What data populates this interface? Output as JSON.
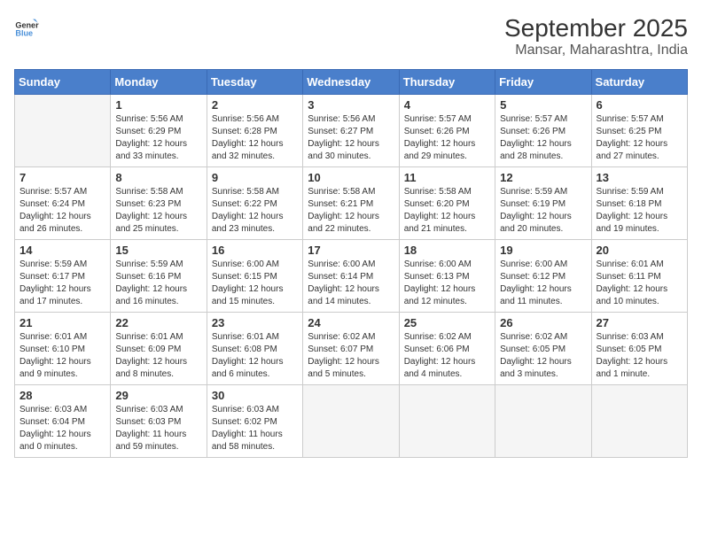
{
  "header": {
    "logo_line1": "General",
    "logo_line2": "Blue",
    "title": "September 2025",
    "subtitle": "Mansar, Maharashtra, India"
  },
  "weekdays": [
    "Sunday",
    "Monday",
    "Tuesday",
    "Wednesday",
    "Thursday",
    "Friday",
    "Saturday"
  ],
  "weeks": [
    [
      {
        "day": "",
        "content": ""
      },
      {
        "day": "1",
        "content": "Sunrise: 5:56 AM\nSunset: 6:29 PM\nDaylight: 12 hours\nand 33 minutes."
      },
      {
        "day": "2",
        "content": "Sunrise: 5:56 AM\nSunset: 6:28 PM\nDaylight: 12 hours\nand 32 minutes."
      },
      {
        "day": "3",
        "content": "Sunrise: 5:56 AM\nSunset: 6:27 PM\nDaylight: 12 hours\nand 30 minutes."
      },
      {
        "day": "4",
        "content": "Sunrise: 5:57 AM\nSunset: 6:26 PM\nDaylight: 12 hours\nand 29 minutes."
      },
      {
        "day": "5",
        "content": "Sunrise: 5:57 AM\nSunset: 6:26 PM\nDaylight: 12 hours\nand 28 minutes."
      },
      {
        "day": "6",
        "content": "Sunrise: 5:57 AM\nSunset: 6:25 PM\nDaylight: 12 hours\nand 27 minutes."
      }
    ],
    [
      {
        "day": "7",
        "content": "Sunrise: 5:57 AM\nSunset: 6:24 PM\nDaylight: 12 hours\nand 26 minutes."
      },
      {
        "day": "8",
        "content": "Sunrise: 5:58 AM\nSunset: 6:23 PM\nDaylight: 12 hours\nand 25 minutes."
      },
      {
        "day": "9",
        "content": "Sunrise: 5:58 AM\nSunset: 6:22 PM\nDaylight: 12 hours\nand 23 minutes."
      },
      {
        "day": "10",
        "content": "Sunrise: 5:58 AM\nSunset: 6:21 PM\nDaylight: 12 hours\nand 22 minutes."
      },
      {
        "day": "11",
        "content": "Sunrise: 5:58 AM\nSunset: 6:20 PM\nDaylight: 12 hours\nand 21 minutes."
      },
      {
        "day": "12",
        "content": "Sunrise: 5:59 AM\nSunset: 6:19 PM\nDaylight: 12 hours\nand 20 minutes."
      },
      {
        "day": "13",
        "content": "Sunrise: 5:59 AM\nSunset: 6:18 PM\nDaylight: 12 hours\nand 19 minutes."
      }
    ],
    [
      {
        "day": "14",
        "content": "Sunrise: 5:59 AM\nSunset: 6:17 PM\nDaylight: 12 hours\nand 17 minutes."
      },
      {
        "day": "15",
        "content": "Sunrise: 5:59 AM\nSunset: 6:16 PM\nDaylight: 12 hours\nand 16 minutes."
      },
      {
        "day": "16",
        "content": "Sunrise: 6:00 AM\nSunset: 6:15 PM\nDaylight: 12 hours\nand 15 minutes."
      },
      {
        "day": "17",
        "content": "Sunrise: 6:00 AM\nSunset: 6:14 PM\nDaylight: 12 hours\nand 14 minutes."
      },
      {
        "day": "18",
        "content": "Sunrise: 6:00 AM\nSunset: 6:13 PM\nDaylight: 12 hours\nand 12 minutes."
      },
      {
        "day": "19",
        "content": "Sunrise: 6:00 AM\nSunset: 6:12 PM\nDaylight: 12 hours\nand 11 minutes."
      },
      {
        "day": "20",
        "content": "Sunrise: 6:01 AM\nSunset: 6:11 PM\nDaylight: 12 hours\nand 10 minutes."
      }
    ],
    [
      {
        "day": "21",
        "content": "Sunrise: 6:01 AM\nSunset: 6:10 PM\nDaylight: 12 hours\nand 9 minutes."
      },
      {
        "day": "22",
        "content": "Sunrise: 6:01 AM\nSunset: 6:09 PM\nDaylight: 12 hours\nand 8 minutes."
      },
      {
        "day": "23",
        "content": "Sunrise: 6:01 AM\nSunset: 6:08 PM\nDaylight: 12 hours\nand 6 minutes."
      },
      {
        "day": "24",
        "content": "Sunrise: 6:02 AM\nSunset: 6:07 PM\nDaylight: 12 hours\nand 5 minutes."
      },
      {
        "day": "25",
        "content": "Sunrise: 6:02 AM\nSunset: 6:06 PM\nDaylight: 12 hours\nand 4 minutes."
      },
      {
        "day": "26",
        "content": "Sunrise: 6:02 AM\nSunset: 6:05 PM\nDaylight: 12 hours\nand 3 minutes."
      },
      {
        "day": "27",
        "content": "Sunrise: 6:03 AM\nSunset: 6:05 PM\nDaylight: 12 hours\nand 1 minute."
      }
    ],
    [
      {
        "day": "28",
        "content": "Sunrise: 6:03 AM\nSunset: 6:04 PM\nDaylight: 12 hours\nand 0 minutes."
      },
      {
        "day": "29",
        "content": "Sunrise: 6:03 AM\nSunset: 6:03 PM\nDaylight: 11 hours\nand 59 minutes."
      },
      {
        "day": "30",
        "content": "Sunrise: 6:03 AM\nSunset: 6:02 PM\nDaylight: 11 hours\nand 58 minutes."
      },
      {
        "day": "",
        "content": ""
      },
      {
        "day": "",
        "content": ""
      },
      {
        "day": "",
        "content": ""
      },
      {
        "day": "",
        "content": ""
      }
    ]
  ]
}
